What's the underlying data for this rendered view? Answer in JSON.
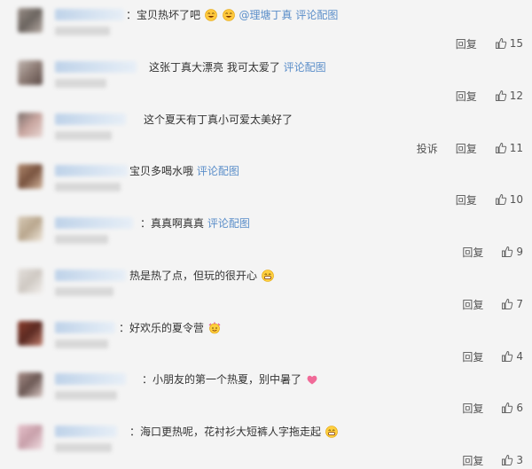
{
  "labels": {
    "reply": "回复",
    "report": "投诉"
  },
  "colors": {
    "link": "#5b8ec9",
    "background": "#f4f4f4"
  },
  "comments": [
    {
      "prefix": "：",
      "text": "宝贝热坏了吧",
      "emojis": [
        "sweat-smile-emoji",
        "sweat-smile-emoji"
      ],
      "mention": "@理塘丁真",
      "link": "评论配图",
      "likes": "15",
      "report": false
    },
    {
      "prefix": "",
      "text": "这张丁真大漂亮 我可太爱了",
      "emojis": [],
      "mention": "",
      "link": "评论配图",
      "likes": "12",
      "report": false
    },
    {
      "prefix": "",
      "text": "这个夏天有丁真小可爱太美好了",
      "emojis": [],
      "mention": "",
      "link": "",
      "likes": "11",
      "report": true
    },
    {
      "prefix": "",
      "text": "宝贝多喝水哦",
      "emojis": [],
      "mention": "",
      "link": "评论配图",
      "likes": "10",
      "report": false
    },
    {
      "prefix": "：",
      "text": "真真啊真真",
      "emojis": [],
      "mention": "",
      "link": "评论配图",
      "likes": "9",
      "report": false
    },
    {
      "prefix": "",
      "text": "热是热了点，但玩的很开心",
      "emojis": [
        "grin-emoji"
      ],
      "mention": "",
      "link": "",
      "likes": "7",
      "report": false
    },
    {
      "prefix": "：",
      "text": "好欢乐的夏令营",
      "emojis": [
        "party-emoji"
      ],
      "mention": "",
      "link": "",
      "likes": "4",
      "report": false
    },
    {
      "prefix": "：",
      "text": "小朋友的第一个热夏，别中暑了",
      "emojis": [
        "heart-emoji"
      ],
      "mention": "",
      "link": "",
      "likes": "6",
      "report": false
    },
    {
      "prefix": "：",
      "text": "海口更热呢，花衬衫大短裤人字拖走起",
      "emojis": [
        "grin-emoji"
      ],
      "mention": "",
      "link": "",
      "likes": "3",
      "report": false
    }
  ]
}
